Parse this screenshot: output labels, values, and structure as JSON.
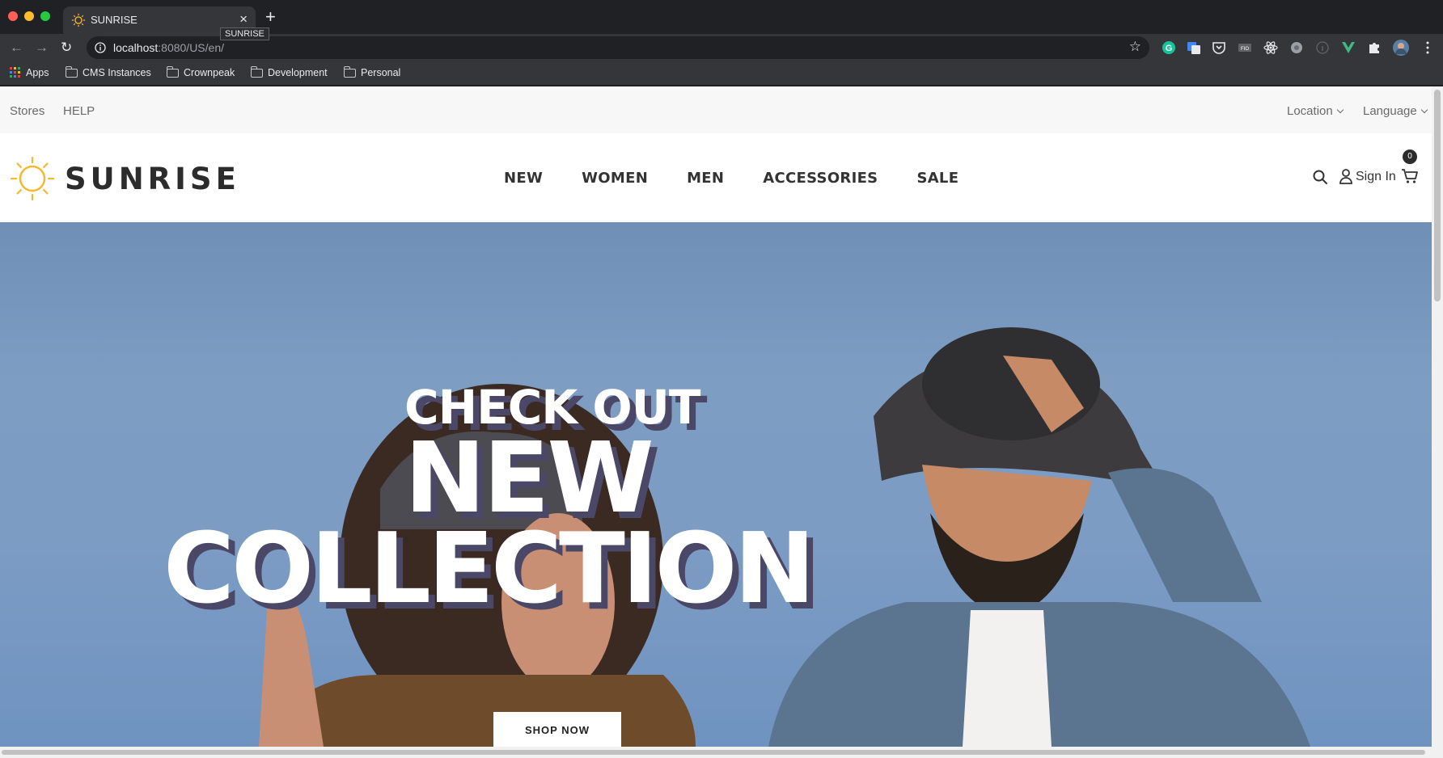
{
  "browser": {
    "tab_title": "SUNRISE",
    "tooltip": "SUNRISE",
    "new_tab": "+",
    "close": "×",
    "url_host": "localhost",
    "url_path": ":8080/US/en/",
    "bookmarks": {
      "apps": "Apps",
      "cms": "CMS Instances",
      "crownpeak": "Crownpeak",
      "development": "Development",
      "personal": "Personal"
    },
    "extensions": [
      "grammarly-icon",
      "google-translate-icon",
      "pocket-icon",
      "fio-icon",
      "react-devtools-icon",
      "extension-gray-icon",
      "info-extension-icon",
      "vue-devtools-icon",
      "puzzle-icon",
      "profile-avatar-icon",
      "kebab-menu-icon"
    ]
  },
  "topbar": {
    "stores": "Stores",
    "help": "HELP",
    "location": "Location",
    "language": "Language"
  },
  "header": {
    "logo_text": "SUNRISE",
    "nav": [
      "NEW",
      "WOMEN",
      "MEN",
      "ACCESSORIES",
      "SALE"
    ],
    "sign_in": "Sign In",
    "cart_count": "0"
  },
  "hero": {
    "line1": "CHECK OUT",
    "line2": "NEW",
    "line3": "COLLECTION",
    "cta": "SHOP NOW"
  },
  "colors": {
    "brand_yellow": "#f5b92e",
    "hero_shadow": "#4b4766",
    "sky": "#7c9cc4"
  }
}
